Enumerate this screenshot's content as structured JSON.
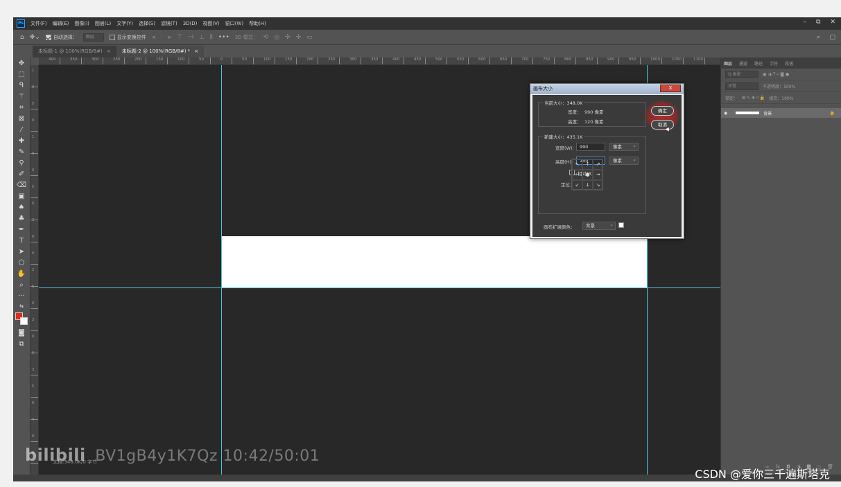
{
  "menubar": {
    "items": [
      "文件(F)",
      "编辑(E)",
      "图像(I)",
      "图层(L)",
      "文字(Y)",
      "选择(S)",
      "滤镜(T)",
      "3D(D)",
      "视图(V)",
      "窗口(W)",
      "帮助(H)"
    ],
    "window_controls": [
      "–",
      "⧉",
      "✕"
    ]
  },
  "options_bar": {
    "auto_select_label": "自动选择：",
    "auto_select_value": "图层",
    "show_transform_label": "显示变换控件",
    "mode_3d_label": "3D 模式："
  },
  "tabs": [
    {
      "label": "未标题-1 @ 100%(RGB/8#)",
      "close": "×"
    },
    {
      "label": "未标题-2 @ 100%(RGB/8#) *",
      "close": "×"
    }
  ],
  "rulers": {
    "h_ticks": [
      "400",
      "350",
      "300",
      "250",
      "200",
      "150",
      "100",
      "50",
      "0",
      "50",
      "100",
      "150",
      "200",
      "250",
      "300",
      "350",
      "400",
      "450",
      "500",
      "550",
      "600",
      "650",
      "700",
      "750",
      "800",
      "850",
      "900",
      "950",
      "1000",
      "1050",
      "1100"
    ],
    "v_ticks": [
      "1",
      "0",
      "5",
      "0",
      "1",
      "0",
      "0",
      "5",
      "0",
      "2",
      "0",
      "0",
      "2",
      "5",
      "0",
      "3",
      "0",
      "0",
      "3",
      "5",
      "0",
      "4",
      "0",
      "0"
    ]
  },
  "statusbar": {
    "text": "文档:348.0K/0 字节"
  },
  "layers_panel": {
    "tabs": [
      "图层",
      "通道",
      "路径",
      "字符",
      "段落"
    ],
    "filter_label": "Q 类型",
    "blend_mode": "正常",
    "opacity_label": "不透明度：100%",
    "lock_label": "锁定：",
    "fill_label": "填充：100%",
    "layer_name": "背景",
    "bottom_icons": [
      "∞",
      "fx",
      "◘",
      "◑",
      "▇",
      "◻",
      "🗑"
    ]
  },
  "dialog": {
    "title": "画布大小",
    "close": "X",
    "current_size_label": "当前大小：348.0K",
    "current_width_label": "宽度：",
    "current_width_value": "990 像素",
    "current_height_label": "高度：",
    "current_height_value": "120 像素",
    "new_size_label": "新建大小：435.1K",
    "width_label": "宽度(W):",
    "width_value": "990",
    "height_label": "高度(H):",
    "height_value": "150",
    "unit": "像素",
    "relative_label": "相对(R)",
    "anchor_label": "定位：",
    "anchor_cells": [
      "↖",
      "↑",
      "↗",
      "←",
      "●",
      "→",
      "↙",
      "↓",
      "↘"
    ],
    "ext_color_label": "画布扩展颜色：",
    "ext_color_value": "背景",
    "ok_label": "确定",
    "cancel_label": "取消"
  },
  "watermarks": {
    "bili_logo": "bilibili",
    "bili_text": "BV1gB4y1K7Qz 10:42/50:01",
    "csdn": "CSDN @爱你三千遍斯塔克"
  },
  "colors": {
    "foreground": "#e32b1b",
    "background": "#ffffff",
    "guide": "#4fc3d9",
    "accent_ok": "#c83232"
  }
}
